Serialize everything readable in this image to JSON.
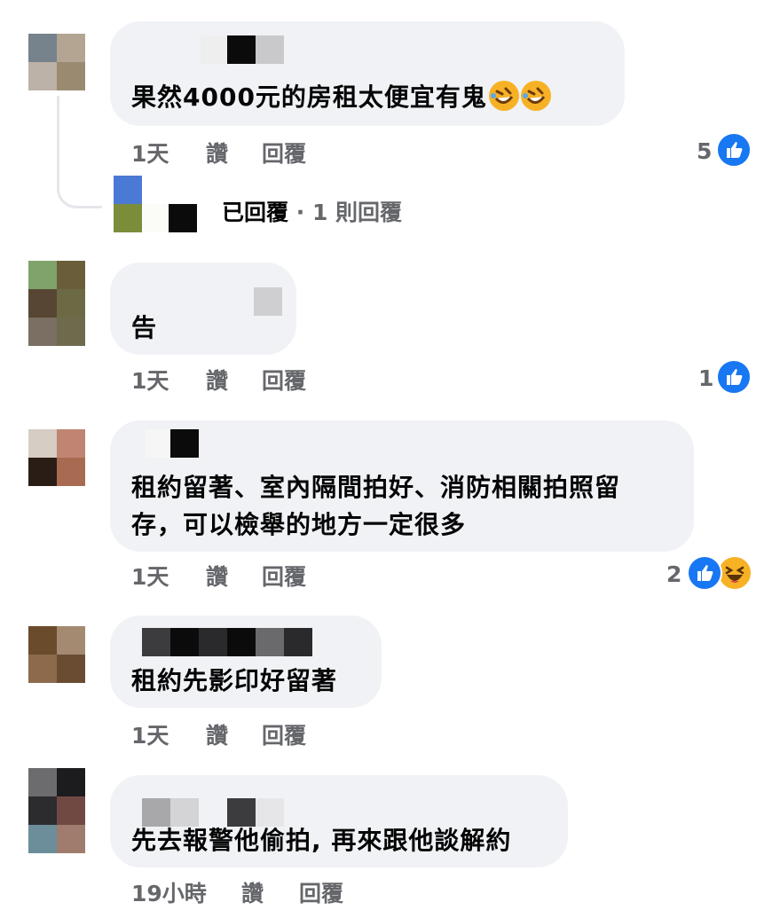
{
  "comments": [
    {
      "text": "果然4000元的房租太便宜有鬼",
      "time": "1天",
      "like": "讚",
      "reply": "回覆",
      "reaction_count": "5",
      "reactions": [
        "like-icon"
      ],
      "reply_summary": {
        "label": "已回覆",
        "separator": "·",
        "count": "1 則回覆"
      }
    },
    {
      "text": "告",
      "time": "1天",
      "like": "讚",
      "reply": "回覆",
      "reaction_count": "1",
      "reactions": [
        "like-icon"
      ]
    },
    {
      "text_lines": [
        "租約留著、室內隔間拍好、消防相關拍照留",
        "存，可以檢舉的地方一定很多"
      ],
      "time": "1天",
      "like": "讚",
      "reply": "回覆",
      "reaction_count": "2",
      "reactions": [
        "like-icon",
        "haha-icon"
      ]
    },
    {
      "text": "租約先影印好留著",
      "time": "1天",
      "like": "讚",
      "reply": "回覆"
    },
    {
      "text": "先去報警他偷拍, 再來跟他談解約",
      "time": "19小時",
      "like": "讚",
      "reply": "回覆"
    }
  ],
  "colors": {
    "bubble": "#f0f2f5",
    "meta_text": "#65676b",
    "like_blue": "#1877f2",
    "haha_yellow": "#f7b125"
  }
}
